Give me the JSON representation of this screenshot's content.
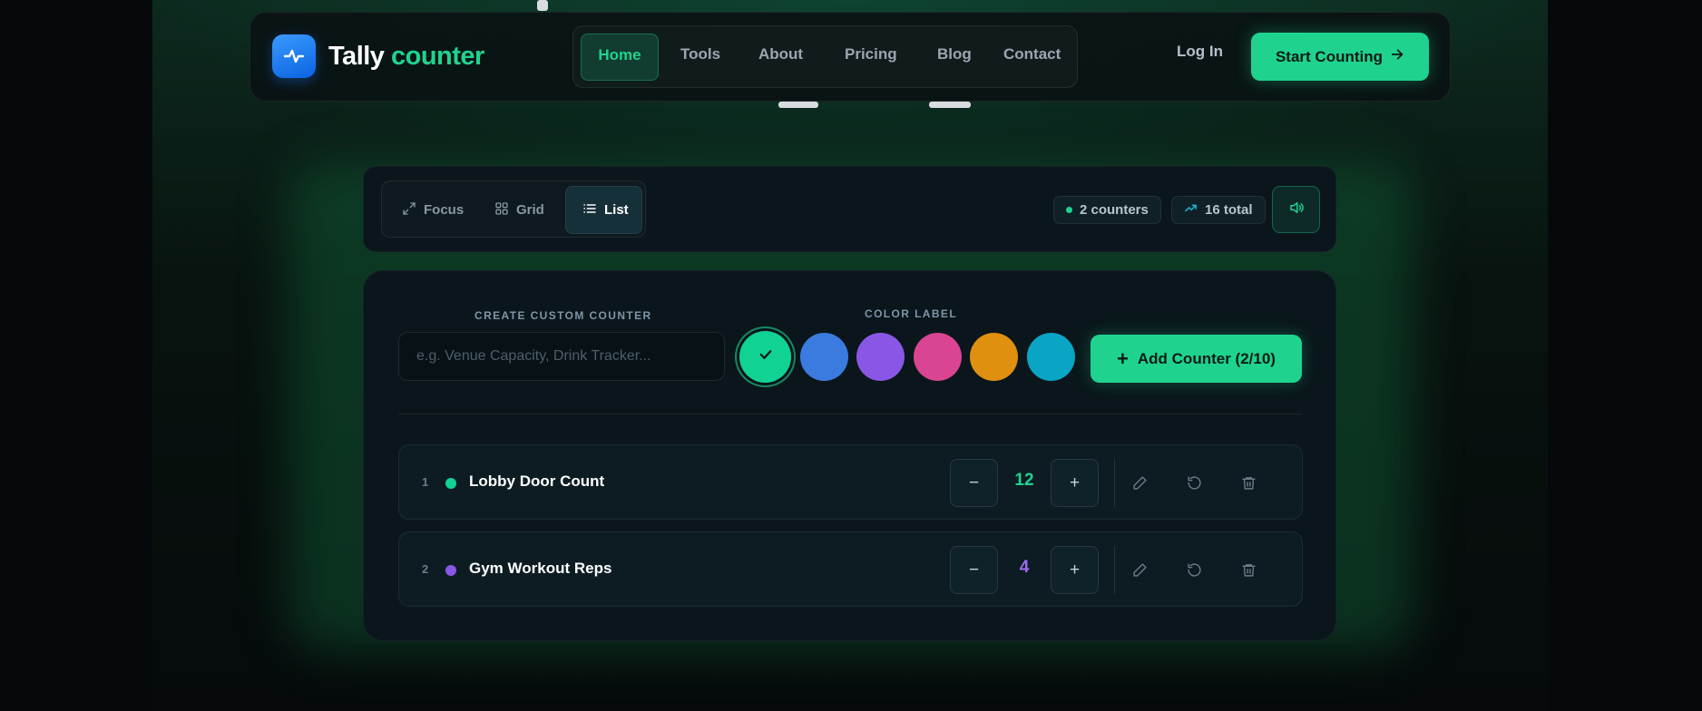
{
  "brand": {
    "word1": "Tally",
    "word2": "counter",
    "icon": "pulse-icon"
  },
  "nav": {
    "items": [
      {
        "label": "Home",
        "active": true
      },
      {
        "label": "Tools"
      },
      {
        "label": "About"
      },
      {
        "label": "Pricing"
      },
      {
        "label": "Blog"
      },
      {
        "label": "Contact"
      }
    ],
    "login": "Log In",
    "cta": "Start Counting",
    "cta_icon": "arrow-right-icon"
  },
  "toolbar": {
    "views": [
      {
        "label": "Focus",
        "icon": "expand-icon"
      },
      {
        "label": "Grid",
        "icon": "grid-icon"
      },
      {
        "label": "List",
        "icon": "list-icon",
        "active": true
      }
    ],
    "counters_stat": "2 counters",
    "total_stat": "16 total",
    "sound_icon": "speaker-icon"
  },
  "create": {
    "label": "CREATE CUSTOM COUNTER",
    "placeholder": "e.g. Venue Capacity, Drink Tracker...",
    "value": "",
    "color_label": "COLOR LABEL",
    "colors": [
      "#10d393",
      "#3b7be0",
      "#8a56e6",
      "#d94592",
      "#e0900f",
      "#0aa4c4"
    ],
    "selected_color": 0,
    "add_label": "Add Counter (2/10)"
  },
  "counters": [
    {
      "index": "1",
      "name": "Lobby Door Count",
      "value": "12",
      "color": "#10d393"
    },
    {
      "index": "2",
      "name": "Gym Workout Reps",
      "value": "4",
      "color": "#8a56e6"
    }
  ],
  "symbols": {
    "minus": "−",
    "plus": "+"
  }
}
